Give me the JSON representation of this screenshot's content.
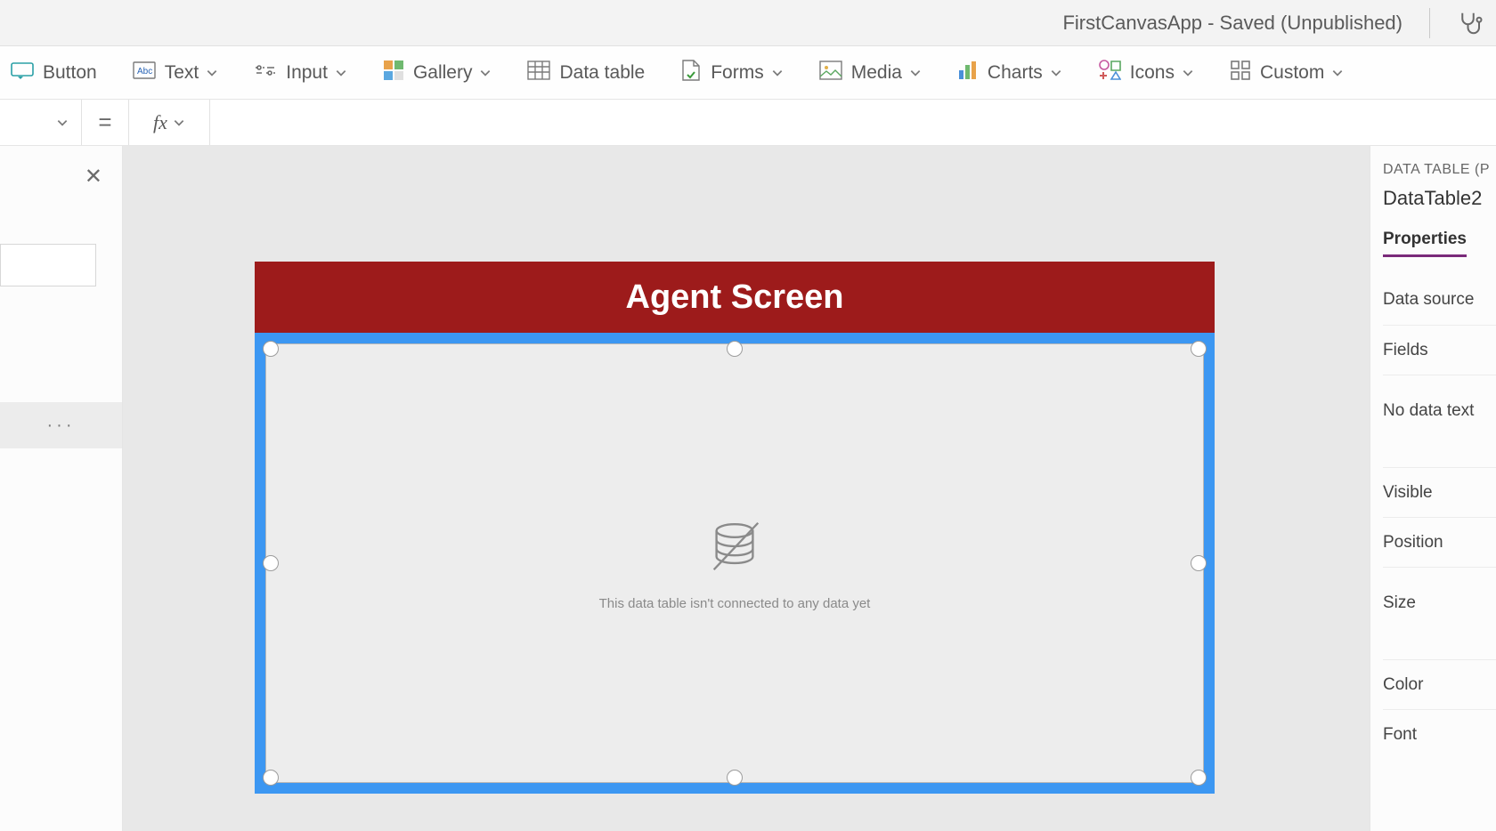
{
  "titlebar": {
    "app_title": "FirstCanvasApp - Saved (Unpublished)"
  },
  "ribbon": {
    "button": "Button",
    "text": "Text",
    "input": "Input",
    "gallery": "Gallery",
    "data_table": "Data table",
    "forms": "Forms",
    "media": "Media",
    "charts": "Charts",
    "icons": "Icons",
    "custom": "Custom"
  },
  "formula": {
    "equals": "=",
    "fx": "fx",
    "value": ""
  },
  "leftpane": {
    "ellipsis": "···"
  },
  "canvas": {
    "screen_title": "Agent Screen",
    "datatable_empty_msg": "This data table isn't connected to any data yet"
  },
  "rightpane": {
    "type_label": "DATA TABLE (P",
    "control_name": "DataTable2",
    "tab_properties": "Properties",
    "rows": {
      "data_source": "Data source",
      "fields": "Fields",
      "no_data_text": "No data text",
      "visible": "Visible",
      "position": "Position",
      "size": "Size",
      "color": "Color",
      "font": "Font"
    }
  }
}
